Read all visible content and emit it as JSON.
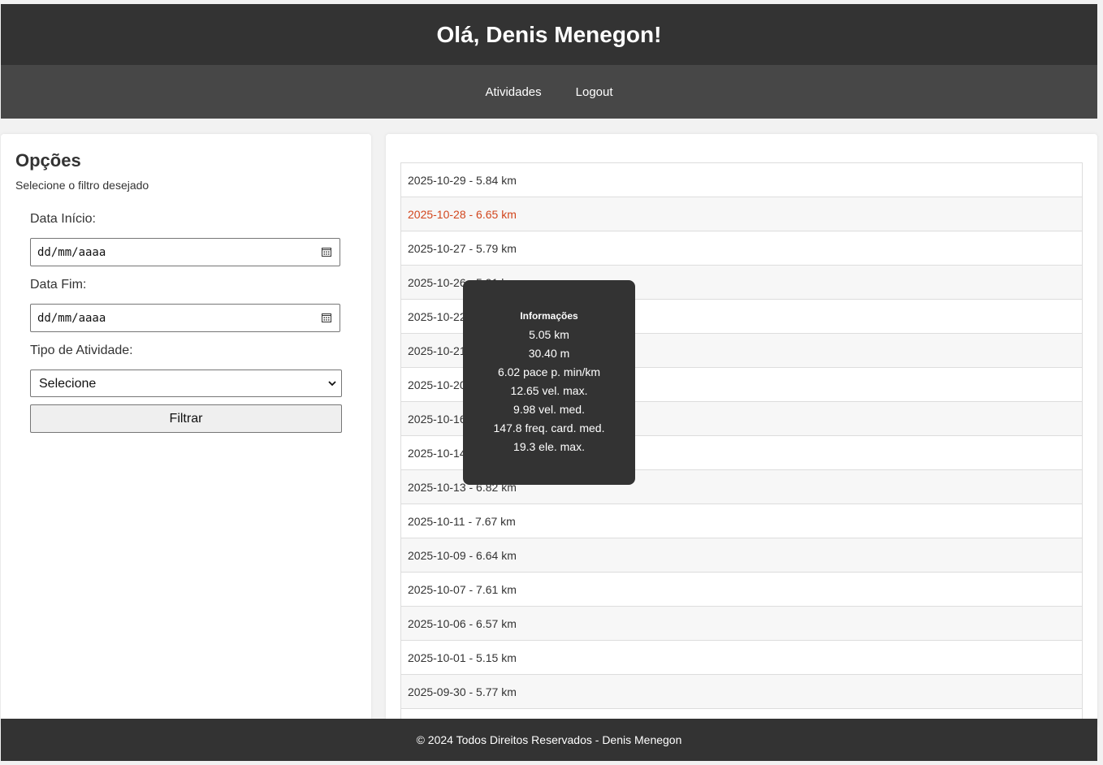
{
  "header": {
    "greeting": "Olá, Denis Menegon!"
  },
  "nav": {
    "items": [
      "Atividades",
      "Logout"
    ]
  },
  "sidebar": {
    "title": "Opções",
    "subtitle": "Selecione o filtro desejado",
    "start_label": "Data Início:",
    "start_placeholder": "dd/mm/aaaa",
    "end_label": "Data Fim:",
    "end_placeholder": "dd/mm/aaaa",
    "type_label": "Tipo de Atividade:",
    "type_selected": "Selecione",
    "filter_button": "Filtrar",
    "icons": {
      "calendar": "calendar-icon",
      "dropdown": "chevron-down-icon"
    }
  },
  "activities": [
    "2025-10-29 - 5.84 km",
    "2025-10-28 - 6.65 km",
    "2025-10-27 - 5.79 km",
    "2025-10-26 - 5.91 km",
    "2025-10-22 -",
    "2025-10-21 -",
    "2025-10-20 -",
    "2025-10-16 -",
    "2025-10-14 -",
    "2025-10-13 - 6.82 km",
    "2025-10-11 - 7.67 km",
    "2025-10-09 - 6.64 km",
    "2025-10-07 - 7.61 km",
    "2025-10-06 - 6.57 km",
    "2025-10-01 - 5.15 km",
    "2025-09-30 - 5.77 km",
    ""
  ],
  "hovered_index": 1,
  "tooltip": {
    "title": "Informações",
    "lines": [
      "5.05 km",
      "30.40 m",
      "6.02 pace p. min/km",
      "12.65 vel. max.",
      "9.98 vel. med.",
      "147.8 freq. card. med.",
      "19.3 ele. max."
    ]
  },
  "footer": {
    "text": "© 2024 Todos Direitos Reservados - Denis Menegon"
  },
  "colors": {
    "header_bg": "#333333",
    "nav_bg": "#474747",
    "hover_text": "#d2461d",
    "tooltip_bg": "#333333"
  }
}
